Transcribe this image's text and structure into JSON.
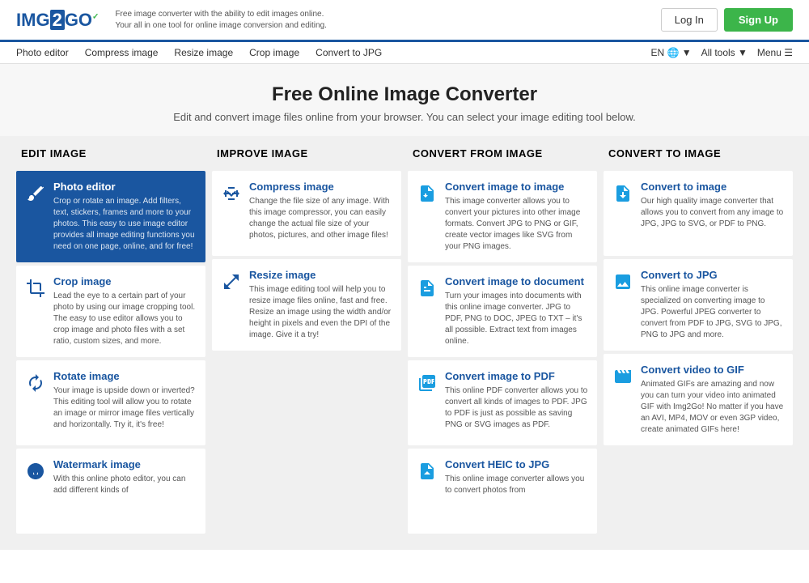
{
  "header": {
    "logo_img": "IMG2GO",
    "logo_two": "2",
    "tagline_line1": "Free image converter with the ability to edit images online.",
    "tagline_line2": "Your all in one tool for online image conversion and editing.",
    "login_label": "Log In",
    "signup_label": "Sign Up"
  },
  "nav": {
    "links": [
      {
        "label": "Photo editor"
      },
      {
        "label": "Compress image"
      },
      {
        "label": "Resize image"
      },
      {
        "label": "Crop image"
      },
      {
        "label": "Convert to JPG"
      }
    ],
    "right_lang": "EN",
    "right_tools": "All tools",
    "right_menu": "Menu"
  },
  "hero": {
    "title": "Free Online Image Converter",
    "subtitle": "Edit and convert image files online from your browser. You can select your image editing tool below."
  },
  "columns": [
    {
      "id": "edit",
      "header": "EDIT IMAGE",
      "cards": [
        {
          "title": "Photo editor",
          "desc": "Crop or rotate an image. Add filters, text, stickers, frames and more to your photos. This easy to use image editor provides all image editing functions you need on one page, online, and for free!",
          "icon": "brush",
          "active": true
        },
        {
          "title": "Crop image",
          "desc": "Lead the eye to a certain part of your photo by using our image cropping tool. The easy to use editor allows you to crop image and photo files with a set ratio, custom sizes, and more.",
          "icon": "crop",
          "active": false
        },
        {
          "title": "Rotate image",
          "desc": "Your image is upside down or inverted? This editing tool will allow you to rotate an image or mirror image files vertically and horizontally. Try it, it's free!",
          "icon": "rotate",
          "active": false
        },
        {
          "title": "Watermark image",
          "desc": "With this online photo editor, you can add different kinds of",
          "icon": "watermark",
          "active": false
        }
      ]
    },
    {
      "id": "improve",
      "header": "IMPROVE IMAGE",
      "cards": [
        {
          "title": "Compress image",
          "desc": "Change the file size of any image. With this image compressor, you can easily change the actual file size of your photos, pictures, and other image files!",
          "icon": "compress",
          "active": false
        },
        {
          "title": "Resize image",
          "desc": "This image editing tool will help you to resize image files online, fast and free. Resize an image using the width and/or height in pixels and even the DPI of the image. Give it a try!",
          "icon": "resize",
          "active": false
        }
      ]
    },
    {
      "id": "convert-from",
      "header": "CONVERT FROM IMAGE",
      "cards": [
        {
          "title": "Convert image to image",
          "desc": "This image converter allows you to convert your pictures into other image formats. Convert JPG to PNG or GIF, create vector images like SVG from your PNG images.",
          "icon": "convert-img",
          "active": false
        },
        {
          "title": "Convert image to document",
          "desc": "Turn your images into documents with this online image converter. JPG to PDF, PNG to DOC, JPEG to TXT – it's all possible. Extract text from images online.",
          "icon": "convert-doc",
          "active": false
        },
        {
          "title": "Convert image to PDF",
          "desc": "This online PDF converter allows you to convert all kinds of images to PDF. JPG to PDF is just as possible as saving PNG or SVG images as PDF.",
          "icon": "convert-pdf",
          "active": false
        },
        {
          "title": "Convert HEIC to JPG",
          "desc": "This online image converter allows you to convert photos from",
          "icon": "convert-heic",
          "active": false
        }
      ]
    },
    {
      "id": "convert-to",
      "header": "CONVERT TO IMAGE",
      "cards": [
        {
          "title": "Convert to image",
          "desc": "Our high quality image converter that allows you to convert from any image to JPG, JPG to SVG, or PDF to PNG.",
          "icon": "convert-to-img",
          "active": false
        },
        {
          "title": "Convert to JPG",
          "desc": "This online image converter is specialized on converting image to JPG. Powerful JPEG converter to convert from PDF to JPG, SVG to JPG, PNG to JPG and more.",
          "icon": "convert-to-jpg",
          "active": false
        },
        {
          "title": "Convert video to GIF",
          "desc": "Animated GIFs are amazing and now you can turn your video into animated GIF with Img2Go! No matter if you have an AVI, MP4, MOV or even 3GP video, create animated GIFs here!",
          "icon": "convert-video",
          "active": false
        }
      ]
    }
  ]
}
